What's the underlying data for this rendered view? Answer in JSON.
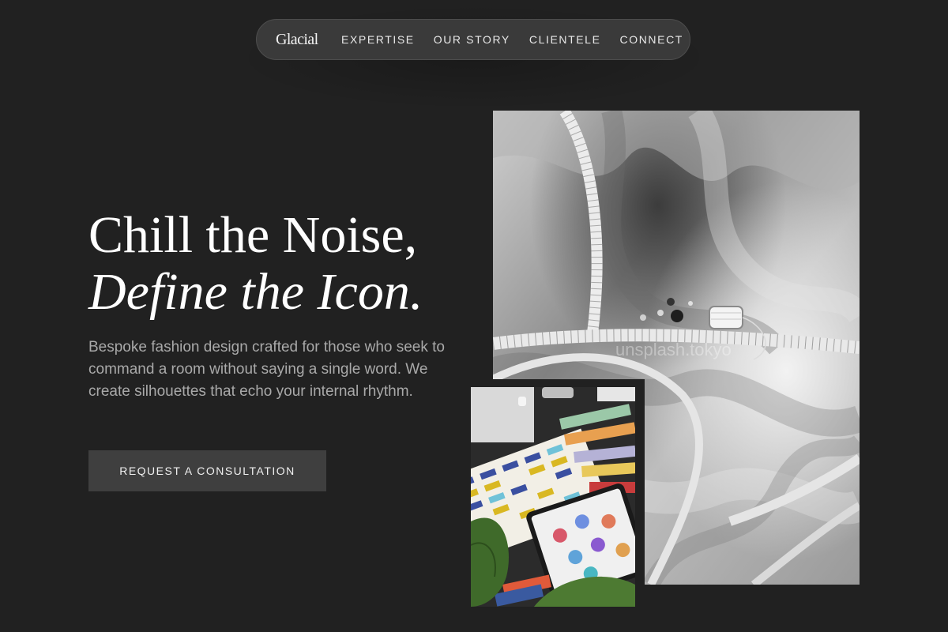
{
  "nav": {
    "logo": "Glacial",
    "links": [
      "EXPERTISE",
      "OUR STORY",
      "CLIENTELE",
      "CONNECT"
    ]
  },
  "hero": {
    "title_line1": "Chill the Noise,",
    "title_line2": "Define the Icon.",
    "description": "Bespoke fashion design crafted for those who seek to command a room without saying a single word. We create silhouettes that echo your internal rhythm.",
    "cta": "REQUEST A CONSULTATION"
  },
  "images": {
    "main_watermark": "unsplash.tokyo"
  },
  "colors": {
    "background": "#212121",
    "nav_pill": "#3a3a3a",
    "button": "#3f3f3f",
    "body_text": "#a9a9a9"
  }
}
